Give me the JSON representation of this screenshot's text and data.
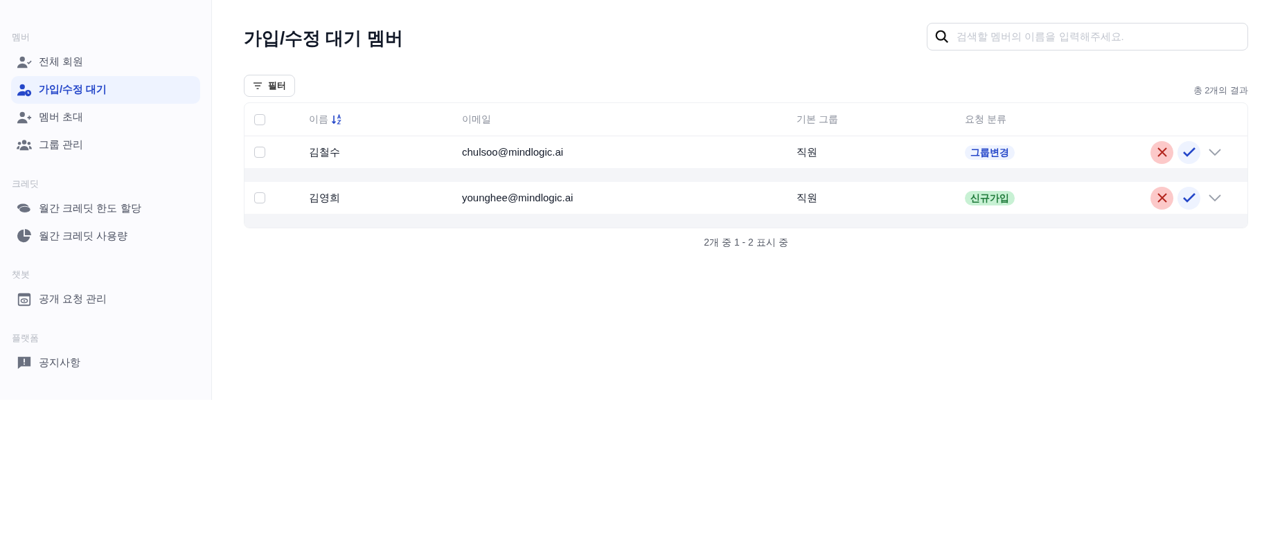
{
  "sidebar": {
    "sections": [
      {
        "label": "멤버",
        "items": [
          {
            "label": "전체 회원",
            "selected": false
          },
          {
            "label": "가입/수정 대기",
            "selected": true
          },
          {
            "label": "멤버 초대",
            "selected": false
          },
          {
            "label": "그룹 관리",
            "selected": false
          }
        ]
      },
      {
        "label": "크레딧",
        "items": [
          {
            "label": "월간 크레딧 한도 할당",
            "selected": false
          },
          {
            "label": "월간 크레딧 사용량",
            "selected": false
          }
        ]
      },
      {
        "label": "챗봇",
        "items": [
          {
            "label": "공개 요청 관리",
            "selected": false
          }
        ]
      },
      {
        "label": "플랫폼",
        "items": [
          {
            "label": "공지사항",
            "selected": false
          }
        ]
      }
    ]
  },
  "page": {
    "title": "가입/수정 대기 멤버",
    "search": {
      "placeholder": "검색할 멤버의 이름을 입력해주세요."
    },
    "filter_button": "필터",
    "result_count": "총 2개의 결과"
  },
  "table": {
    "select_all_checked": false,
    "columns": [
      "이름",
      "이메일",
      "기본 그룹",
      "요청 분류"
    ],
    "rows": [
      {
        "checked": false,
        "name": "김철수",
        "email": "chulsoo@mindlogic.ai",
        "group": "직원",
        "request": {
          "label": "그룹변경",
          "color": "#2547c9"
        }
      },
      {
        "checked": false,
        "name": "김영희",
        "email": "younghee@mindlogic.ai",
        "group": "직원",
        "request": {
          "label": "신규가입",
          "color": "#1f7a3a"
        }
      }
    ]
  },
  "pagination": "2개 중 1 - 2 표시 중"
}
